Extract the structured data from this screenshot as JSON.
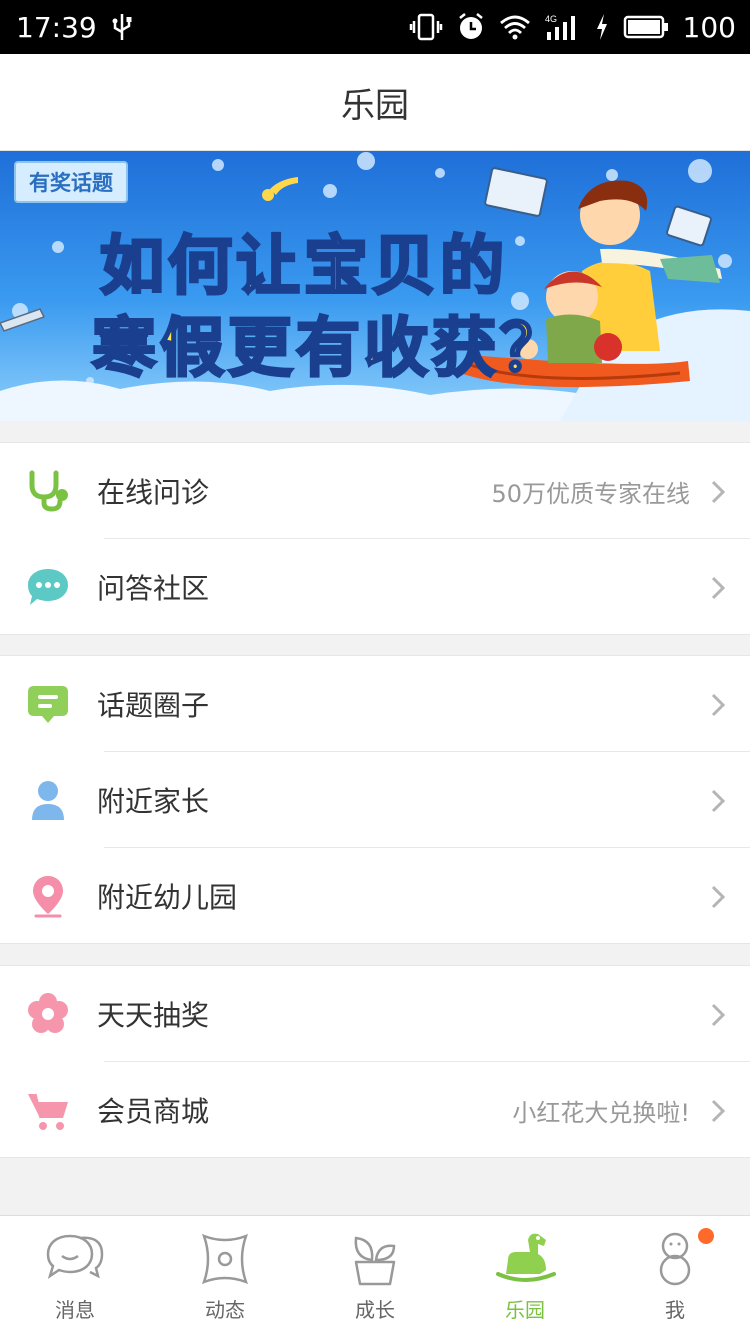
{
  "status_bar": {
    "time": "17:39",
    "battery": "100",
    "icons": [
      "usb-icon",
      "vibrate-icon",
      "alarm-icon",
      "wifi-icon",
      "signal-4g-icon",
      "charging-icon",
      "battery-icon"
    ]
  },
  "header": {
    "title": "乐园"
  },
  "banner": {
    "badge": "有奖话题",
    "headline_line1": "如何让宝贝的",
    "headline_line2": "寒假更有收获？"
  },
  "sections": [
    {
      "rows": [
        {
          "icon": "stethoscope-icon",
          "label": "在线问诊",
          "hint": "50万优质专家在线",
          "color": "#7cc242"
        },
        {
          "icon": "chat-bubble-icon",
          "label": "问答社区",
          "hint": "",
          "color": "#5cc9c5"
        }
      ]
    },
    {
      "rows": [
        {
          "icon": "topic-bubble-icon",
          "label": "话题圈子",
          "hint": "",
          "color": "#8fcf5a"
        },
        {
          "icon": "person-icon",
          "label": "附近家长",
          "hint": "",
          "color": "#7db7ec"
        },
        {
          "icon": "location-pin-icon",
          "label": "附近幼儿园",
          "hint": "",
          "color": "#f58ea8"
        }
      ]
    },
    {
      "rows": [
        {
          "icon": "flower-icon",
          "label": "天天抽奖",
          "hint": "",
          "color": "#f596ad"
        },
        {
          "icon": "shopping-cart-icon",
          "label": "会员商城",
          "hint": "小红花大兑换啦!",
          "color": "#f596ad"
        }
      ]
    }
  ],
  "tabbar": {
    "tabs": [
      {
        "label": "消息",
        "icon": "message-icon",
        "active": false
      },
      {
        "label": "动态",
        "icon": "pinwheel-icon",
        "active": false
      },
      {
        "label": "成长",
        "icon": "plant-pot-icon",
        "active": false
      },
      {
        "label": "乐园",
        "icon": "rocking-horse-icon",
        "active": true
      },
      {
        "label": "我",
        "icon": "snowman-user-icon",
        "active": false
      }
    ]
  },
  "colors": {
    "accent": "#7cc242",
    "notification_dot": "#ff6a2a"
  }
}
